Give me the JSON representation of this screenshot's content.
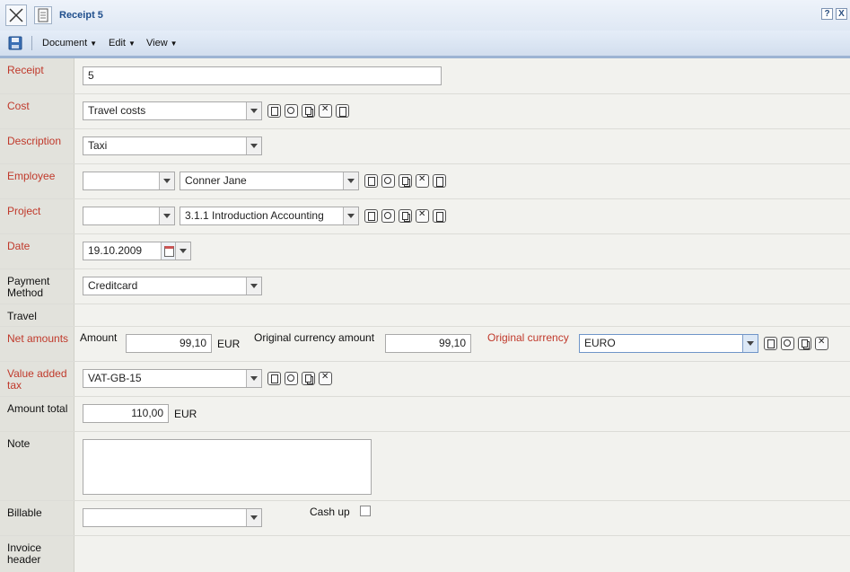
{
  "window": {
    "title": "Receipt 5",
    "help": "?",
    "close": "X"
  },
  "menu": {
    "items": [
      "Document",
      "Edit",
      "View"
    ]
  },
  "form": {
    "receipt": {
      "label": "Receipt",
      "value": "5"
    },
    "cost": {
      "label": "Cost",
      "value": "Travel costs"
    },
    "description": {
      "label": "Description",
      "value": "Taxi"
    },
    "employee": {
      "label": "Employee",
      "prefix": "",
      "value": "Conner Jane"
    },
    "project": {
      "label": "Project",
      "prefix": "",
      "value": "3.1.1 Introduction Accounting"
    },
    "date": {
      "label": "Date",
      "value": "19.10.2009"
    },
    "payment_method": {
      "label": "Payment Method",
      "value": "Creditcard"
    },
    "travel": {
      "label": "Travel"
    },
    "net_amounts": {
      "label": "Net amounts",
      "amount_label": "Amount",
      "amount": "99,10",
      "currency": "EUR",
      "original_amount_label": "Original currency amount",
      "original_amount": "99,10",
      "original_currency_label": "Original currency",
      "original_currency": "EURO"
    },
    "vat": {
      "label": "Value added tax",
      "value": "VAT-GB-15"
    },
    "amount_total": {
      "label": "Amount total",
      "value": "110,00",
      "currency": "EUR"
    },
    "note": {
      "label": "Note",
      "value": ""
    },
    "billable": {
      "label": "Billable",
      "value": ""
    },
    "cash_up": {
      "label": "Cash up",
      "checked": false
    },
    "invoice_header": {
      "label": "Invoice header"
    }
  }
}
